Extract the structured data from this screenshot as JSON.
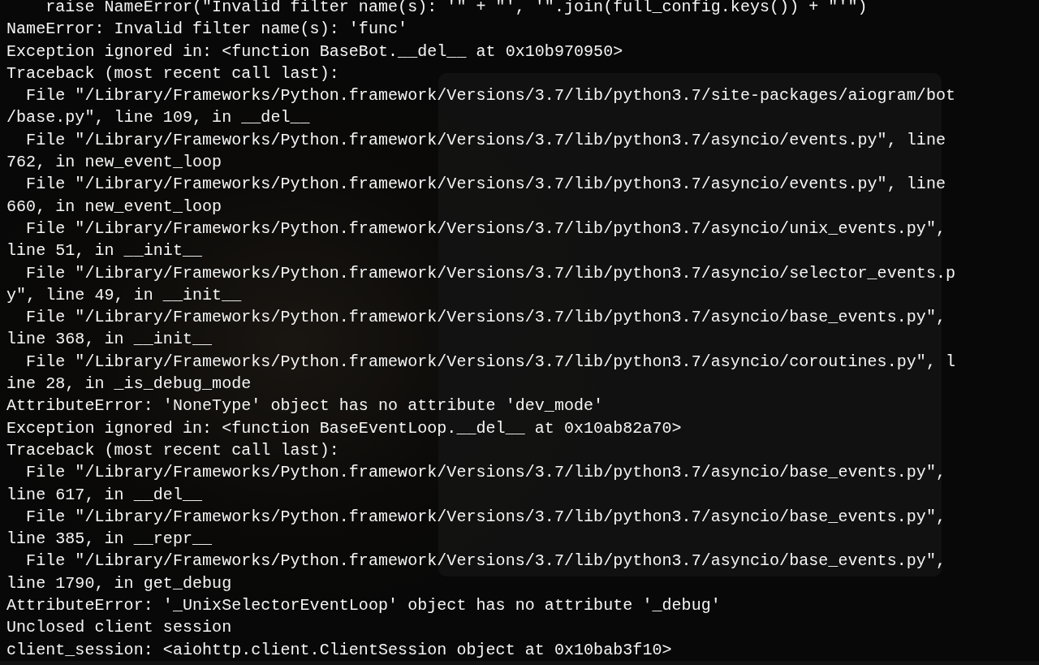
{
  "terminal": {
    "lines": [
      "    raise NameError(\"Invalid filter name(s): '\" + \"', '\".join(full_config.keys()) + \"'\")",
      "NameError: Invalid filter name(s): 'func'",
      "Exception ignored in: <function BaseBot.__del__ at 0x10b970950>",
      "Traceback (most recent call last):",
      "  File \"/Library/Frameworks/Python.framework/Versions/3.7/lib/python3.7/site-packages/aiogram/bot",
      "/base.py\", line 109, in __del__",
      "  File \"/Library/Frameworks/Python.framework/Versions/3.7/lib/python3.7/asyncio/events.py\", line",
      "762, in new_event_loop",
      "  File \"/Library/Frameworks/Python.framework/Versions/3.7/lib/python3.7/asyncio/events.py\", line",
      "660, in new_event_loop",
      "  File \"/Library/Frameworks/Python.framework/Versions/3.7/lib/python3.7/asyncio/unix_events.py\",",
      "line 51, in __init__",
      "  File \"/Library/Frameworks/Python.framework/Versions/3.7/lib/python3.7/asyncio/selector_events.p",
      "y\", line 49, in __init__",
      "  File \"/Library/Frameworks/Python.framework/Versions/3.7/lib/python3.7/asyncio/base_events.py\",",
      "line 368, in __init__",
      "  File \"/Library/Frameworks/Python.framework/Versions/3.7/lib/python3.7/asyncio/coroutines.py\", l",
      "ine 28, in _is_debug_mode",
      "AttributeError: 'NoneType' object has no attribute 'dev_mode'",
      "Exception ignored in: <function BaseEventLoop.__del__ at 0x10ab82a70>",
      "Traceback (most recent call last):",
      "  File \"/Library/Frameworks/Python.framework/Versions/3.7/lib/python3.7/asyncio/base_events.py\",",
      "line 617, in __del__",
      "  File \"/Library/Frameworks/Python.framework/Versions/3.7/lib/python3.7/asyncio/base_events.py\",",
      "line 385, in __repr__",
      "  File \"/Library/Frameworks/Python.framework/Versions/3.7/lib/python3.7/asyncio/base_events.py\",",
      "line 1790, in get_debug",
      "AttributeError: '_UnixSelectorEventLoop' object has no attribute '_debug'",
      "Unclosed client session",
      "client_session: <aiohttp.client.ClientSession object at 0x10bab3f10>"
    ]
  }
}
